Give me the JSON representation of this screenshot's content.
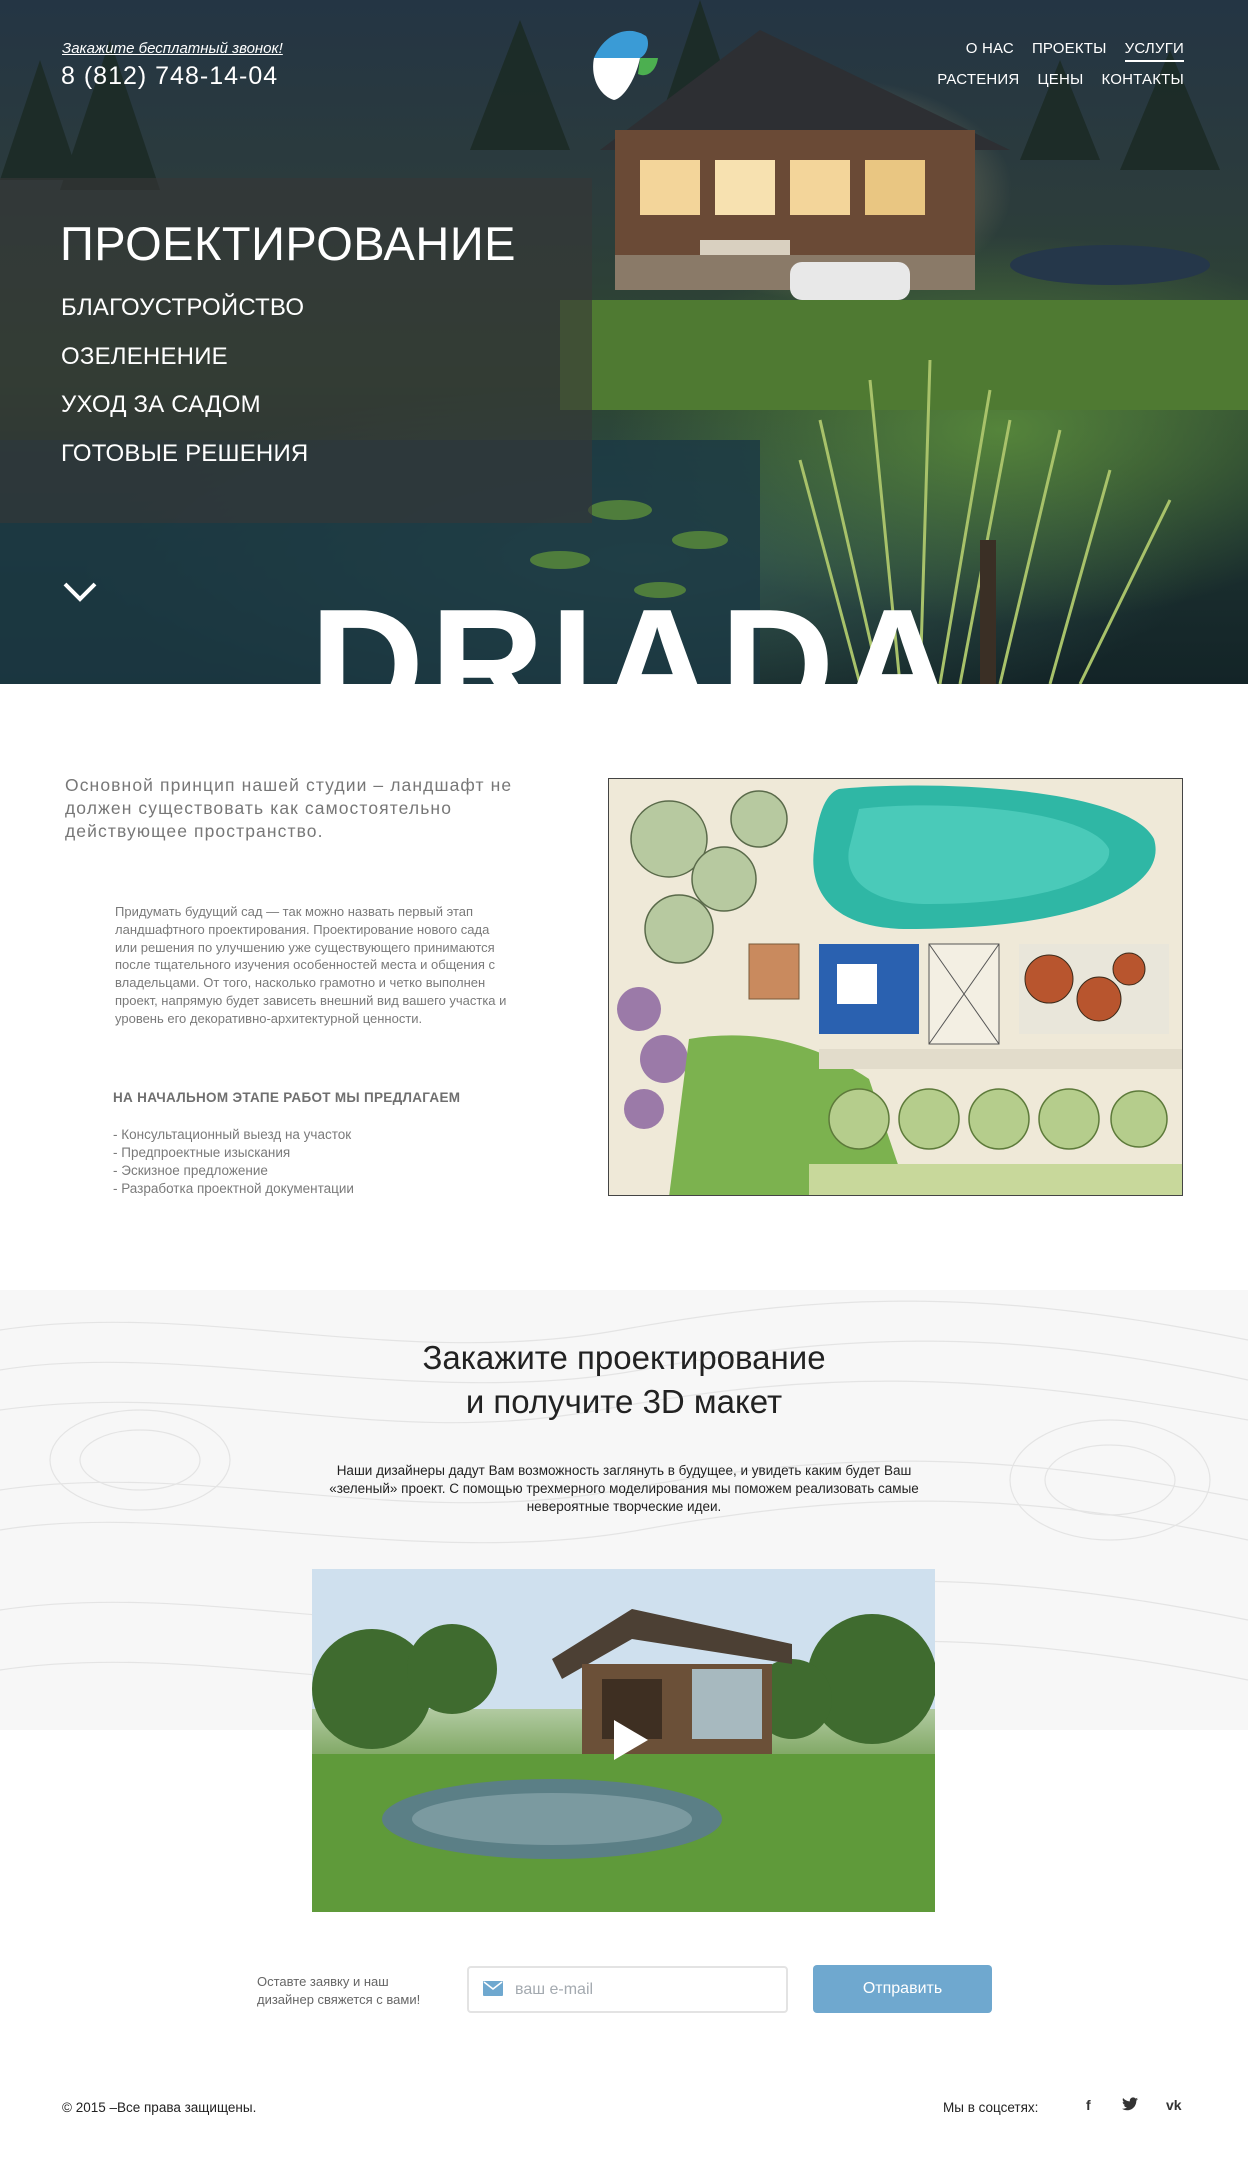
{
  "header": {
    "call_label": "Закажите бесплатный звонок!",
    "phone": "8 (812) 748-14-04",
    "nav_row1": [
      "О НАС",
      "ПРОЕКТЫ",
      "УСЛУГИ"
    ],
    "nav_row2": [
      "РАСТЕНИЯ",
      "ЦЕНЫ",
      "КОНТАКТЫ"
    ],
    "active_nav": "УСЛУГИ"
  },
  "hero": {
    "title": "ПРОЕКТИРОВАНИЕ",
    "menu": [
      "БЛАГОУСТРОЙСТВО",
      "ОЗЕЛЕНЕНИЕ",
      "УХОД ЗА САДОМ",
      "ГОТОВЫЕ РЕШЕНИЯ"
    ],
    "brand": "DRIADA"
  },
  "intro": {
    "lead": "Основной принцип нашей студии – ландшафт не должен существовать как самостоятельно действующее пространство.",
    "body": "Придумать будущий сад — так можно назвать первый этап ландшафтного проектирования. Проектирование нового сада или решения по улучшению уже существующего принимаются после тщательного изучения особенностей места и общения с владельцами. От того, насколько грамотно и четко выполнен проект, напрямую будет зависеть внешний вид вашего участка и уровень его декоративно-архитектурной ценности.",
    "offer_title": "НА НАЧАЛЬНОМ ЭТАПЕ РАБОТ МЫ ПРЕДЛАГАЕМ",
    "offer_items": [
      "Консультационный выезд на участок",
      "Предпроектные изыскания",
      "Эскизное предложение",
      "Разработка проектной документации"
    ]
  },
  "cta": {
    "title_line1": "Закажите проектирование",
    "title_line2": "и получите 3D макет",
    "description": "Наши дизайнеры дадут Вам возможность заглянуть в будущее, и увидеть каким будет Ваш «зеленый» проект.  С помощью трехмерного моделирования мы поможем реализовать самые невероятные творческие идеи."
  },
  "form": {
    "note": "Оставте заявку и наш дизайнер свяжется с вами!",
    "email_placeholder": "ваш e-mail",
    "submit_label": "Отправить"
  },
  "footer": {
    "copyright": "© 2015 –Все права защищены.",
    "social_label": "Мы в соцсетях:",
    "social": [
      "f",
      "t",
      "vk"
    ]
  },
  "colors": {
    "accent": "#6fa8cf",
    "overlay": "#373737",
    "logo_blue": "#3a9bd6",
    "logo_green": "#4caf50"
  },
  "icons": [
    "logo-icon",
    "chevron-down-icon",
    "play-icon",
    "mail-icon",
    "facebook-icon",
    "twitter-icon",
    "vk-icon"
  ]
}
